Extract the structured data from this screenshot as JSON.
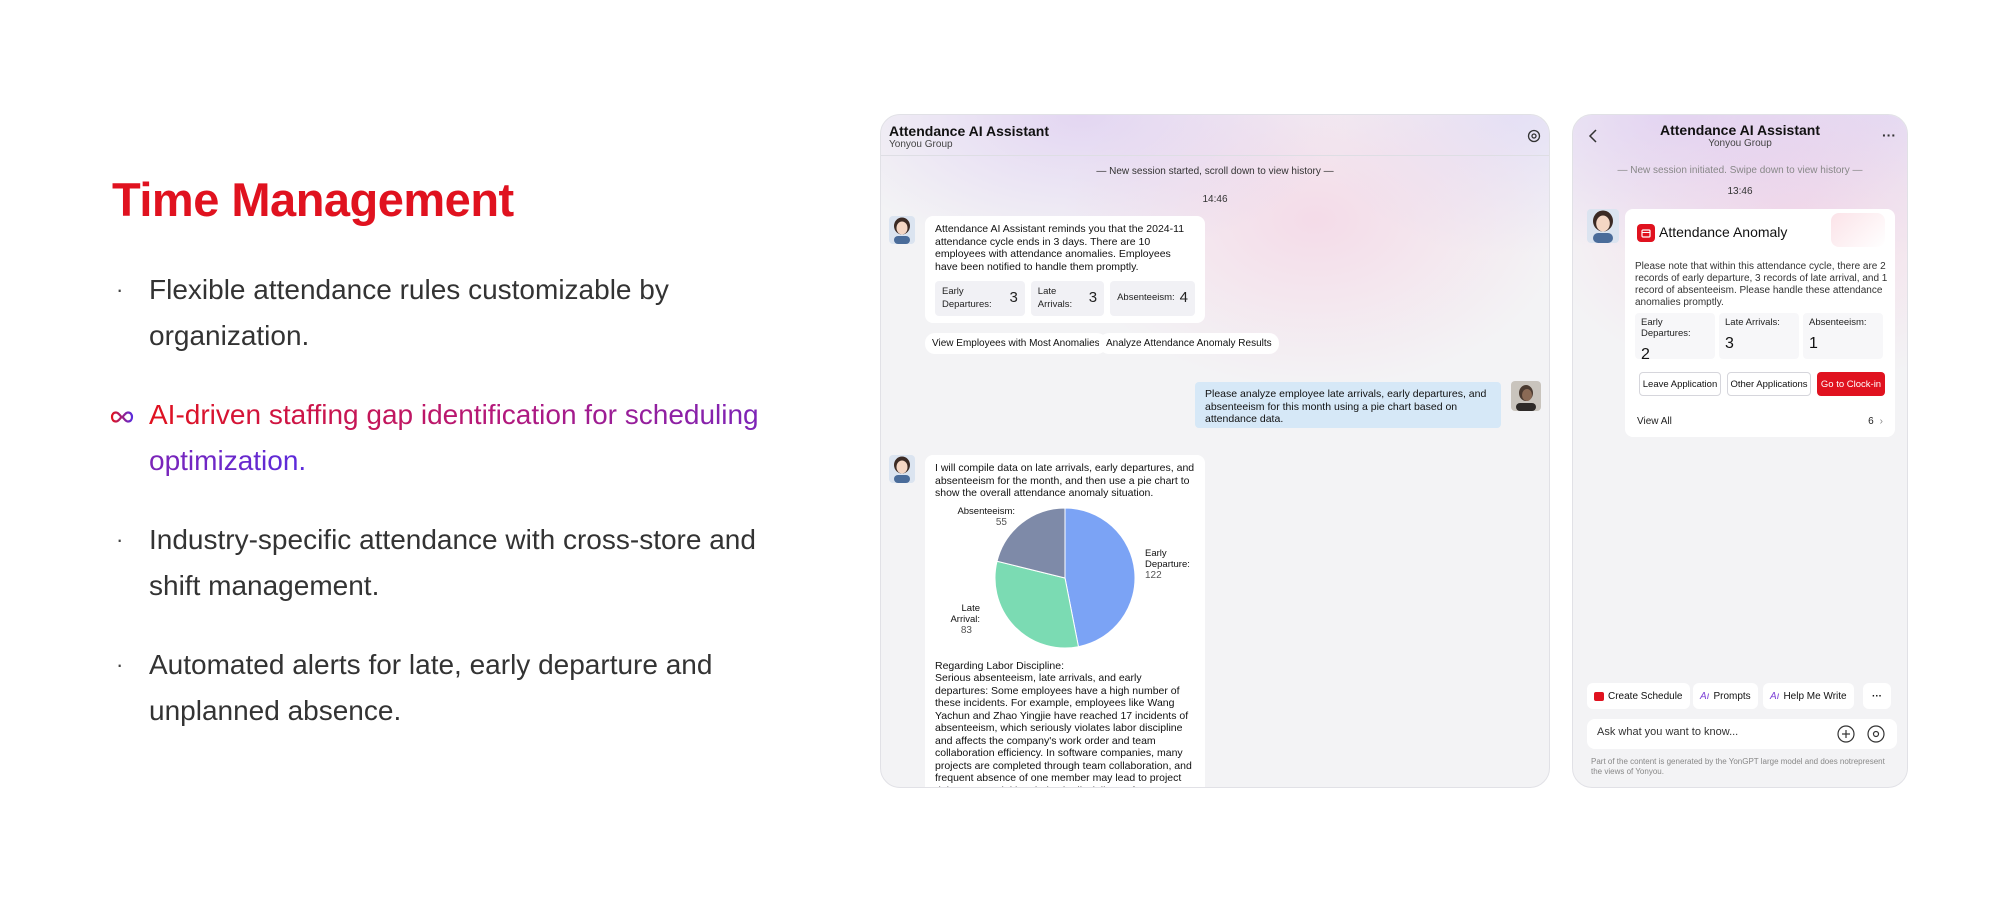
{
  "left": {
    "title": "Time Management",
    "features": [
      "Flexible attendance rules customizable by organization.",
      "AI-driven staffing gap identification for scheduling optimization.",
      "Industry-specific attendance with cross-store and shift management.",
      "Automated alerts for late, early departure and unplanned absence."
    ]
  },
  "desktop": {
    "title": "Attendance AI Assistant",
    "subtitle": "Yonyou Group",
    "system_message": "— New session started, scroll down to view history —",
    "time": "14:46",
    "reminder": "Attendance AI Assistant reminds you that the 2024-11 attendance cycle ends in 3 days. There are 10 employees with attendance anomalies. Employees have been notified to handle them promptly.",
    "stats": [
      {
        "label": "Early Departures:",
        "value": "3"
      },
      {
        "label": "Late Arrivals:",
        "value": "3"
      },
      {
        "label": "Absenteeism:",
        "value": "4"
      }
    ],
    "suggestions": [
      "View Employees with Most Anomalies",
      "Analyze Attendance Anomaly Results"
    ],
    "user_message": "Please analyze employee late arrivals, early departures, and absenteeism for this month using a pie chart based on attendance data.",
    "reply_intro": "I will compile data on late arrivals, early departures, and absenteeism for the month, and then use a pie chart to show the overall attendance anomaly situation.",
    "reply_body": "Regarding Labor Discipline:\nSerious absenteeism, late arrivals, and early departures: Some employees have a high number of these incidents. For example, employees like Wang Yachun and Zhao Yingjie have reached 17 incidents of absenteeism, which seriously violates labor discipline and affects the company's work order and team collaboration efficiency. In software companies, many projects are completed through team collaboration, and frequent absence of one member may lead to project delays. Potential loopholes in discipline enforcement: The high"
  },
  "chart_data": {
    "type": "pie",
    "slices": [
      {
        "label": "Early Departure:",
        "value": 122,
        "color": "#7ba3f5"
      },
      {
        "label": "Late Arrival:",
        "value": 83,
        "color": "#7bdbb3"
      },
      {
        "label": "Absenteeism:",
        "value": 55,
        "color": "#7e8aa8"
      }
    ]
  },
  "mobile": {
    "title": "Attendance AI Assistant",
    "subtitle": "Yonyou Group",
    "system_message": "— New session initiated. Swipe down to view history —",
    "time": "13:46",
    "card_title": "Attendance Anomaly",
    "card_text": "Please note that within this attendance cycle, there are 2 records of early departure, 3 records of late arrival, and 1 record of absenteeism. Please handle these attendance anomalies promptly.",
    "stats": [
      {
        "label": "Early Departures:",
        "value": "2"
      },
      {
        "label": "Late Arrivals:",
        "value": "3"
      },
      {
        "label": "Absenteeism:",
        "value": "1"
      }
    ],
    "buttons": {
      "leave": "Leave Application",
      "other": "Other Applications",
      "clockin": "Go to Clock-in"
    },
    "view_all": "View All",
    "view_all_count": "6",
    "chips": [
      "Create Schedule",
      "Prompts",
      "Help Me Write"
    ],
    "input_placeholder": "Ask what you want to know...",
    "disclaimer": "Part of the content is generated by the YonGPT large model and does notrepresent the views of Yonyou.",
    "colors": {
      "accent": "#e0121f"
    }
  }
}
